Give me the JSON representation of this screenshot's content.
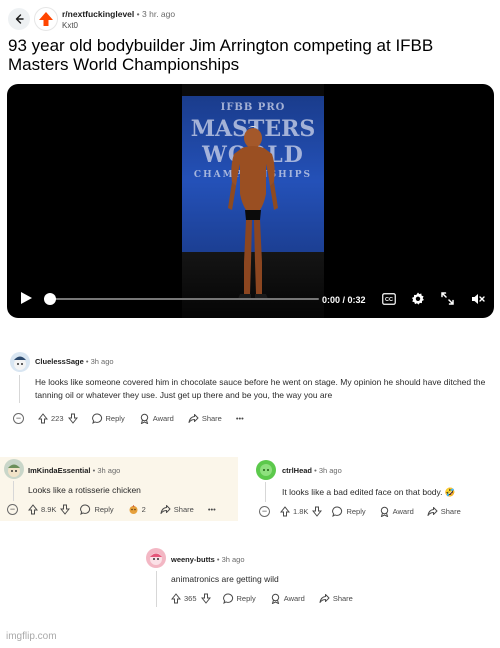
{
  "post": {
    "subreddit": "r/nextfuckinglevel",
    "dot": "•",
    "time_ago": "3 hr. ago",
    "username": "Kxt0",
    "title": "93 year old bodybuilder Jim Arrington competing at IFBB Masters World Championships"
  },
  "video": {
    "banner_line1": "IFBB PRO",
    "banner_line2": "MASTERS",
    "banner_line3": "WORLD",
    "banner_line4": "CHAMPIONSHIPS",
    "time": "0:00 / 0:32",
    "progress": 0.0,
    "cc_label": "CC"
  },
  "comments": [
    {
      "author": "CluelessSage",
      "time": "3h ago",
      "text": "He looks like someone covered him in chocolate sauce before he went on stage. My opinion he should have ditched the tanning oil or whatever they use. Just get up there and be you, the way you are",
      "votes": "223",
      "reply": "Reply",
      "award": "Award",
      "share": "Share",
      "more": "•••"
    },
    {
      "author": "ImKindaEssential",
      "time": "3h ago",
      "text": "Looks like a rotisserie chicken",
      "votes": "8.9K",
      "reply": "Reply",
      "award_count": "2",
      "share": "Share",
      "more": "•••"
    },
    {
      "author": "ctrlHead",
      "time": "3h ago",
      "text": "It looks like a bad edited face on that body. 🤣",
      "votes": "1.8K",
      "reply": "Reply",
      "award": "Award",
      "share": "Share"
    },
    {
      "author": "weeny-butts",
      "time": "3h ago",
      "text": "animatronics are getting wild",
      "votes": "365",
      "reply": "Reply",
      "award": "Award",
      "share": "Share"
    }
  ],
  "watermark": "imgflip.com",
  "colors": {
    "reddit_orange": "#ff4500",
    "highlight_bg": "#fbf6ea",
    "video_bg": "#000000"
  }
}
